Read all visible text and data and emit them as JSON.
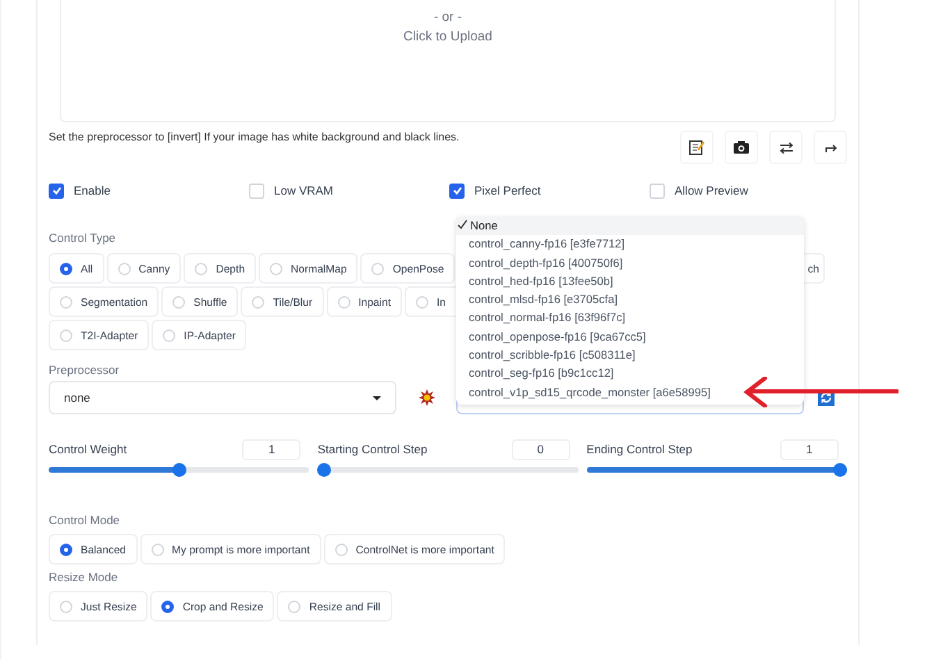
{
  "upload": {
    "or_text": "- or -",
    "prompt": "Click to Upload"
  },
  "hint": "Set the preprocessor to [invert] If your image has white background and black lines.",
  "toolbar": [
    {
      "kind": "edit"
    },
    {
      "kind": "camera"
    },
    {
      "kind": "swap"
    },
    {
      "kind": "send"
    }
  ],
  "checkboxes": [
    {
      "label": "Enable",
      "checked": true
    },
    {
      "label": "Low VRAM",
      "checked": false
    },
    {
      "label": "Pixel Perfect",
      "checked": true
    },
    {
      "label": "Allow Preview",
      "checked": false
    }
  ],
  "control_type": {
    "label": "Control Type",
    "rows": [
      {
        "options": [
          {
            "label": "All",
            "selected": true,
            "kind": "full"
          },
          {
            "label": "Canny",
            "selected": false,
            "kind": "full"
          },
          {
            "label": "Depth",
            "selected": false,
            "kind": "full"
          },
          {
            "label": "NormalMap",
            "selected": false,
            "kind": "full"
          },
          {
            "label": "OpenPose",
            "selected": false,
            "kind": "full"
          },
          {
            "label": "ch",
            "kind": "cut_left"
          }
        ]
      },
      {
        "options": [
          {
            "label": "Segmentation",
            "selected": false,
            "kind": "full"
          },
          {
            "label": "Shuffle",
            "selected": false,
            "kind": "full"
          },
          {
            "label": "Tile/Blur",
            "selected": false,
            "kind": "full"
          },
          {
            "label": "Inpaint",
            "selected": false,
            "kind": "full"
          },
          {
            "label": "In",
            "selected": false,
            "kind": "cut_right"
          }
        ]
      },
      {
        "options": [
          {
            "label": "T2I-Adapter",
            "selected": false,
            "kind": "full"
          },
          {
            "label": "IP-Adapter",
            "selected": false,
            "kind": "full"
          }
        ]
      }
    ]
  },
  "preprocessor": {
    "label": "Preprocessor",
    "value": "none"
  },
  "model_dropdown": {
    "options": [
      {
        "label": "None",
        "selected": true
      },
      {
        "label": "control_canny-fp16 [e3fe7712]",
        "selected": false
      },
      {
        "label": "control_depth-fp16 [400750f6]",
        "selected": false
      },
      {
        "label": "control_hed-fp16 [13fee50b]",
        "selected": false
      },
      {
        "label": "control_mlsd-fp16 [e3705cfa]",
        "selected": false
      },
      {
        "label": "control_normal-fp16 [63f96f7c]",
        "selected": false
      },
      {
        "label": "control_openpose-fp16 [9ca67cc5]",
        "selected": false
      },
      {
        "label": "control_scribble-fp16 [c508311e]",
        "selected": false
      },
      {
        "label": "control_seg-fp16 [b9c1cc12]",
        "selected": false
      },
      {
        "label": "control_v1p_sd15_qrcode_monster [a6e58995]",
        "selected": false
      }
    ]
  },
  "sliders": [
    {
      "label": "Control Weight",
      "value": "1",
      "level": 0.5
    },
    {
      "label": "Starting Control Step",
      "value": "0",
      "level": 0
    },
    {
      "label": "Ending Control Step",
      "value": "1",
      "level": 1
    }
  ],
  "control_mode": {
    "label": "Control Mode",
    "options": [
      {
        "label": "Balanced",
        "selected": true
      },
      {
        "label": "My prompt is more important",
        "selected": false
      },
      {
        "label": "ControlNet is more important",
        "selected": false
      }
    ]
  },
  "resize_mode": {
    "label": "Resize Mode",
    "options": [
      {
        "label": "Just Resize",
        "selected": false
      },
      {
        "label": "Crop and Resize",
        "selected": true
      },
      {
        "label": "Resize and Fill",
        "selected": false
      }
    ]
  }
}
